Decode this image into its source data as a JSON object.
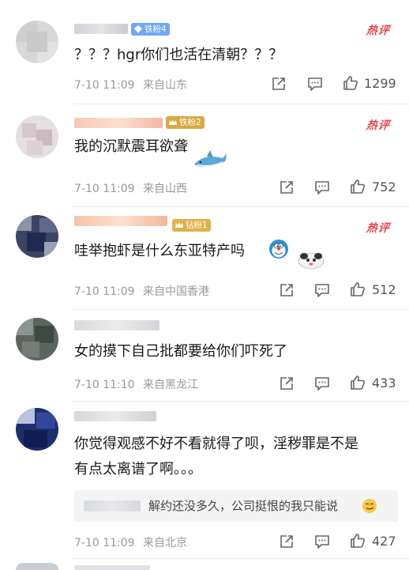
{
  "comments": [
    {
      "badge": "铁粉4",
      "hot_label": "热评",
      "text": "？？？hgr你们也活在清朝？？？",
      "date": "7-10 11:09",
      "location": "来自山东",
      "likes": "1299"
    },
    {
      "badge": "铁粉2",
      "hot_label": "热评",
      "text": "我的沉默震耳欲聋",
      "date": "7-10 11:09",
      "location": "来自山西",
      "likes": "752"
    },
    {
      "badge": "钻粉1",
      "hot_label": "热评",
      "text": "哇举抱虾是什么东亚特产吗",
      "date": "7-10 11:09",
      "location": "来自中国香港",
      "likes": "512"
    },
    {
      "text": "女的摸下自己批都要给你们吓死了",
      "date": "7-10 11:10",
      "location": "来自黑龙江",
      "likes": "433"
    },
    {
      "text_line1": "你觉得观感不好不看就得了呗，淫秽罪是不是",
      "text_line2": "有点太离谱了啊。。。",
      "reply_text": "解约还没多久，公司挺恨的我只能说",
      "date": "7-10 11:09",
      "location": "来自北京",
      "likes": "427"
    }
  ],
  "colors": {
    "hot": "#e8474c",
    "badge_blue": "#5b9cf2",
    "badge_gold": "#d4a33d",
    "meta": "#999999"
  },
  "icons": [
    "share-icon",
    "comment-icon",
    "like-icon",
    "diamond-icon",
    "crown-icon"
  ]
}
